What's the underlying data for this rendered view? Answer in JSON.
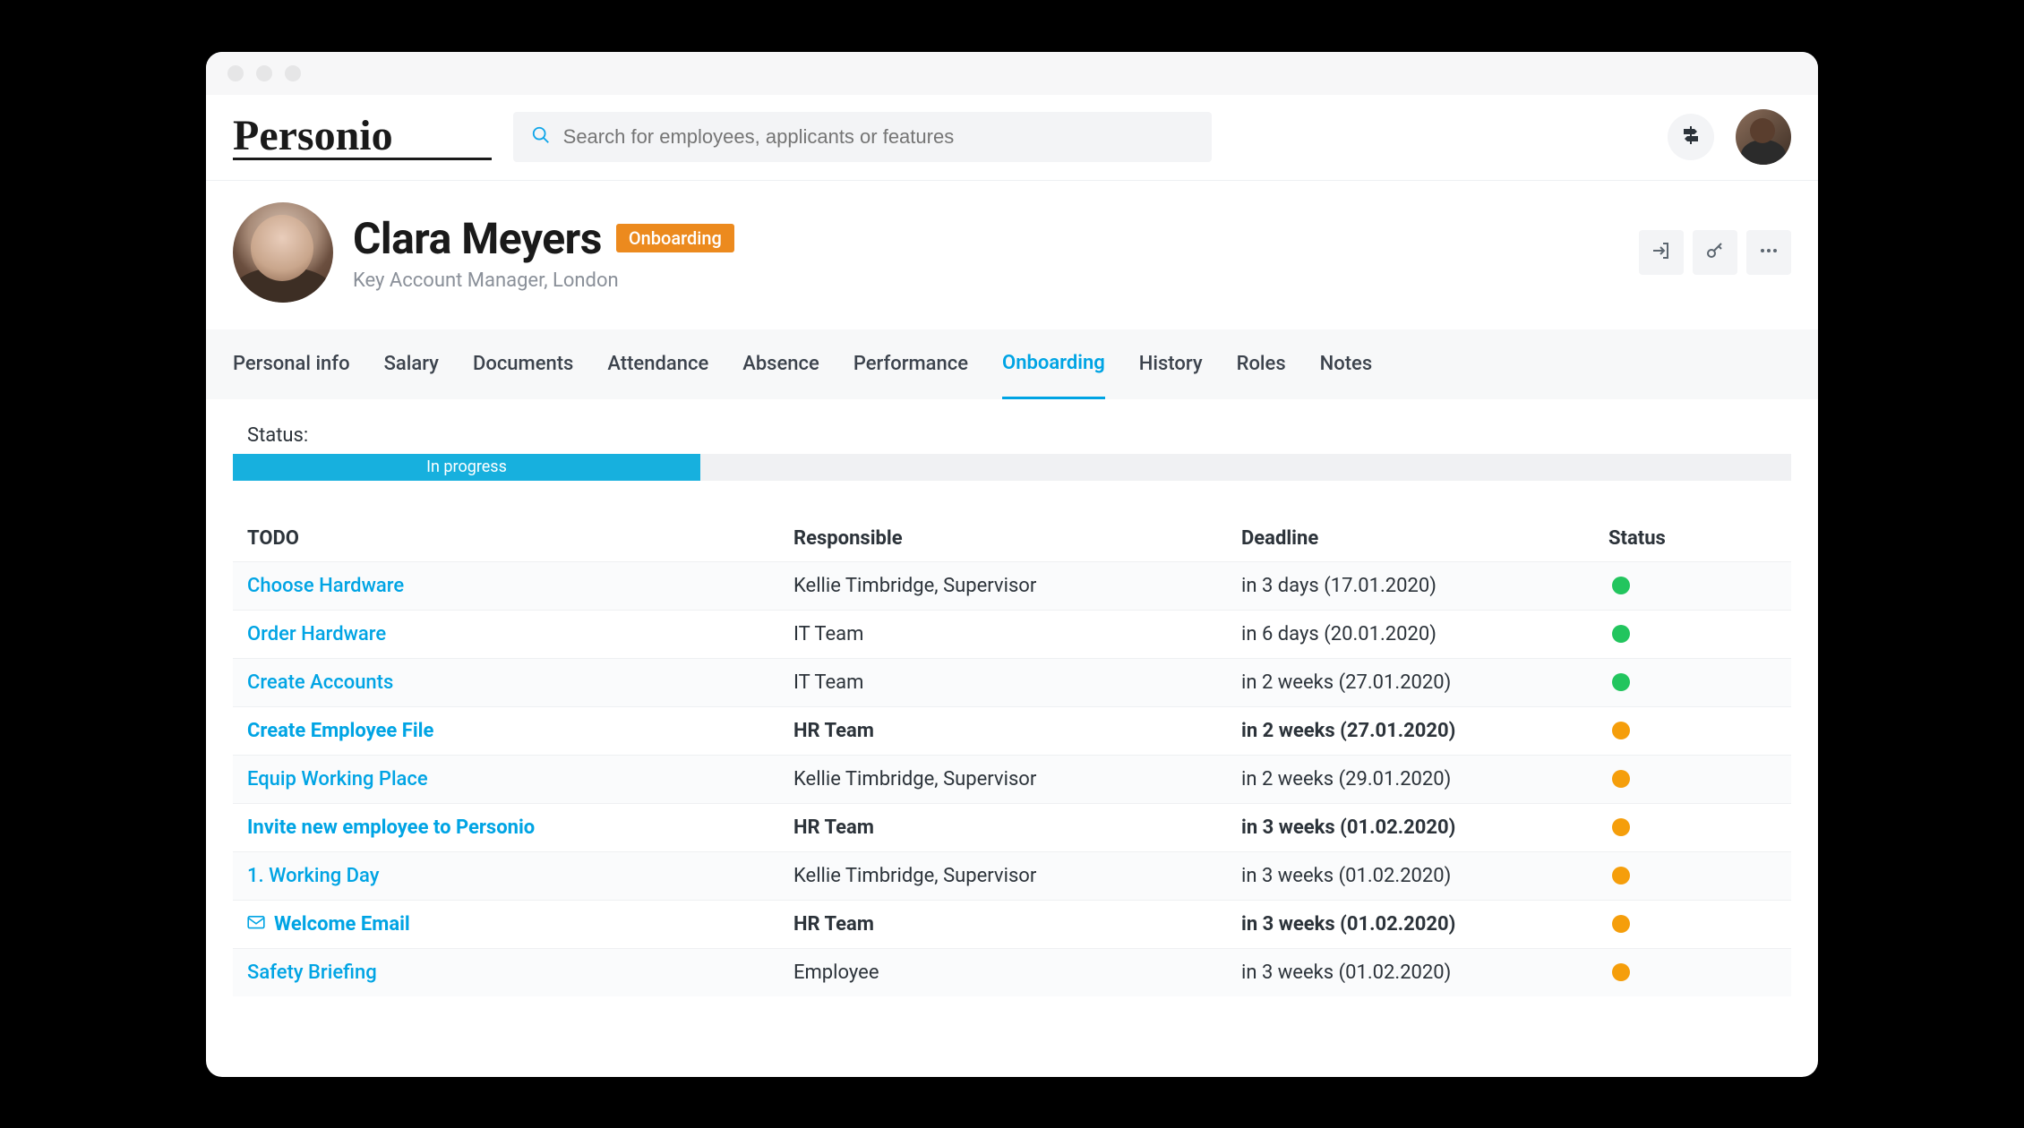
{
  "logo_text": "Personio",
  "search": {
    "placeholder": "Search for employees, applicants or features"
  },
  "profile": {
    "name": "Clara Meyers",
    "badge": "Onboarding",
    "subtitle": "Key Account Manager, London"
  },
  "tabs": [
    {
      "label": "Personal info",
      "active": false
    },
    {
      "label": "Salary",
      "active": false
    },
    {
      "label": "Documents",
      "active": false
    },
    {
      "label": "Attendance",
      "active": false
    },
    {
      "label": "Absence",
      "active": false
    },
    {
      "label": "Performance",
      "active": false
    },
    {
      "label": "Onboarding",
      "active": true
    },
    {
      "label": "History",
      "active": false
    },
    {
      "label": "Roles",
      "active": false
    },
    {
      "label": "Notes",
      "active": false
    }
  ],
  "status": {
    "label": "Status:",
    "progress_label": "In progress",
    "progress_pct": 30
  },
  "table": {
    "headers": {
      "todo": "TODO",
      "responsible": "Responsible",
      "deadline": "Deadline",
      "status": "Status"
    },
    "rows": [
      {
        "todo": "Choose Hardware",
        "responsible": "Kellie Timbridge, Supervisor",
        "deadline": "in 3 days (17.01.2020)",
        "status": "green",
        "bold": false,
        "icon": null,
        "alt": true
      },
      {
        "todo": "Order Hardware",
        "responsible": "IT Team",
        "deadline": "in 6 days (20.01.2020)",
        "status": "green",
        "bold": false,
        "icon": null,
        "alt": false
      },
      {
        "todo": "Create Accounts",
        "responsible": "IT Team",
        "deadline": "in 2 weeks (27.01.2020)",
        "status": "green",
        "bold": false,
        "icon": null,
        "alt": true
      },
      {
        "todo": "Create Employee File",
        "responsible": "HR Team",
        "deadline": "in 2 weeks (27.01.2020)",
        "status": "orange",
        "bold": true,
        "icon": null,
        "alt": false
      },
      {
        "todo": "Equip Working Place",
        "responsible": "Kellie Timbridge, Supervisor",
        "deadline": "in 2 weeks (29.01.2020)",
        "status": "orange",
        "bold": false,
        "icon": null,
        "alt": true
      },
      {
        "todo": "Invite new employee to Personio",
        "responsible": "HR Team",
        "deadline": "in 3 weeks (01.02.2020)",
        "status": "orange",
        "bold": true,
        "icon": null,
        "alt": false
      },
      {
        "todo": "1. Working Day",
        "responsible": "Kellie Timbridge, Supervisor",
        "deadline": "in 3 weeks (01.02.2020)",
        "status": "orange",
        "bold": false,
        "icon": null,
        "alt": true
      },
      {
        "todo": "Welcome Email",
        "responsible": "HR Team",
        "deadline": "in 3 weeks (01.02.2020)",
        "status": "orange",
        "bold": true,
        "icon": "mail",
        "alt": false
      },
      {
        "todo": "Safety Briefing",
        "responsible": "Employee",
        "deadline": "in 3 weeks (01.02.2020)",
        "status": "orange",
        "bold": false,
        "icon": null,
        "alt": true
      }
    ]
  }
}
